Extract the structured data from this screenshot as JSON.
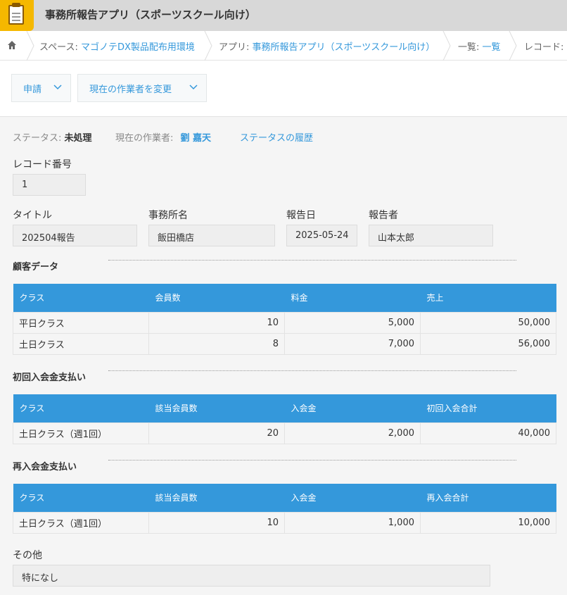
{
  "app": {
    "title": "事務所報告アプリ（スポーツスクール向け）"
  },
  "breadcrumb": {
    "space_label": "スペース:",
    "space_value": "マゴノテDX製品配布用環境",
    "app_label": "アプリ:",
    "app_value": "事務所報告アプリ（スポーツスクール向け）",
    "list_label": "一覧:",
    "list_value": "一覧",
    "record_label": "レコード:"
  },
  "toolbar": {
    "apply_label": "申請",
    "change_worker_label": "現在の作業者を変更"
  },
  "status": {
    "status_label": "ステータス:",
    "status_value": "未処理",
    "worker_label": "現在の作業者:",
    "worker_value": "劉 嘉天",
    "history_link": "ステータスの履歴"
  },
  "record": {
    "number_label": "レコード番号",
    "number_value": "1"
  },
  "fields": {
    "title_label": "タイトル",
    "title_value": "202504報告",
    "office_label": "事務所名",
    "office_value": "飯田橋店",
    "date_label": "報告日",
    "date_value": "2025-05-24",
    "reporter_label": "報告者",
    "reporter_value": "山本太郎"
  },
  "customer": {
    "title": "顧客データ",
    "headers": [
      "クラス",
      "会員数",
      "料金",
      "売上"
    ],
    "rows": [
      [
        "平日クラス",
        "10",
        "5,000",
        "50,000"
      ],
      [
        "土日クラス",
        "8",
        "7,000",
        "56,000"
      ]
    ]
  },
  "first_fee": {
    "title": "初回入会金支払い",
    "headers": [
      "クラス",
      "該当会員数",
      "入会金",
      "初回入会合計"
    ],
    "rows": [
      [
        "土日クラス（週1回）",
        "20",
        "2,000",
        "40,000"
      ]
    ]
  },
  "re_fee": {
    "title": "再入会金支払い",
    "headers": [
      "クラス",
      "該当会員数",
      "入会金",
      "再入会合計"
    ],
    "rows": [
      [
        "土日クラス（週1回）",
        "10",
        "1,000",
        "10,000"
      ]
    ]
  },
  "other": {
    "label": "その他",
    "value": "特になし"
  },
  "colors": {
    "accent": "#3498db",
    "header_bg": "#d8d8d8",
    "icon_bg": "#f5b800"
  },
  "icons": [
    "clipboard-icon",
    "home-icon",
    "chevron-down-icon",
    "chevron-right-icon"
  ]
}
